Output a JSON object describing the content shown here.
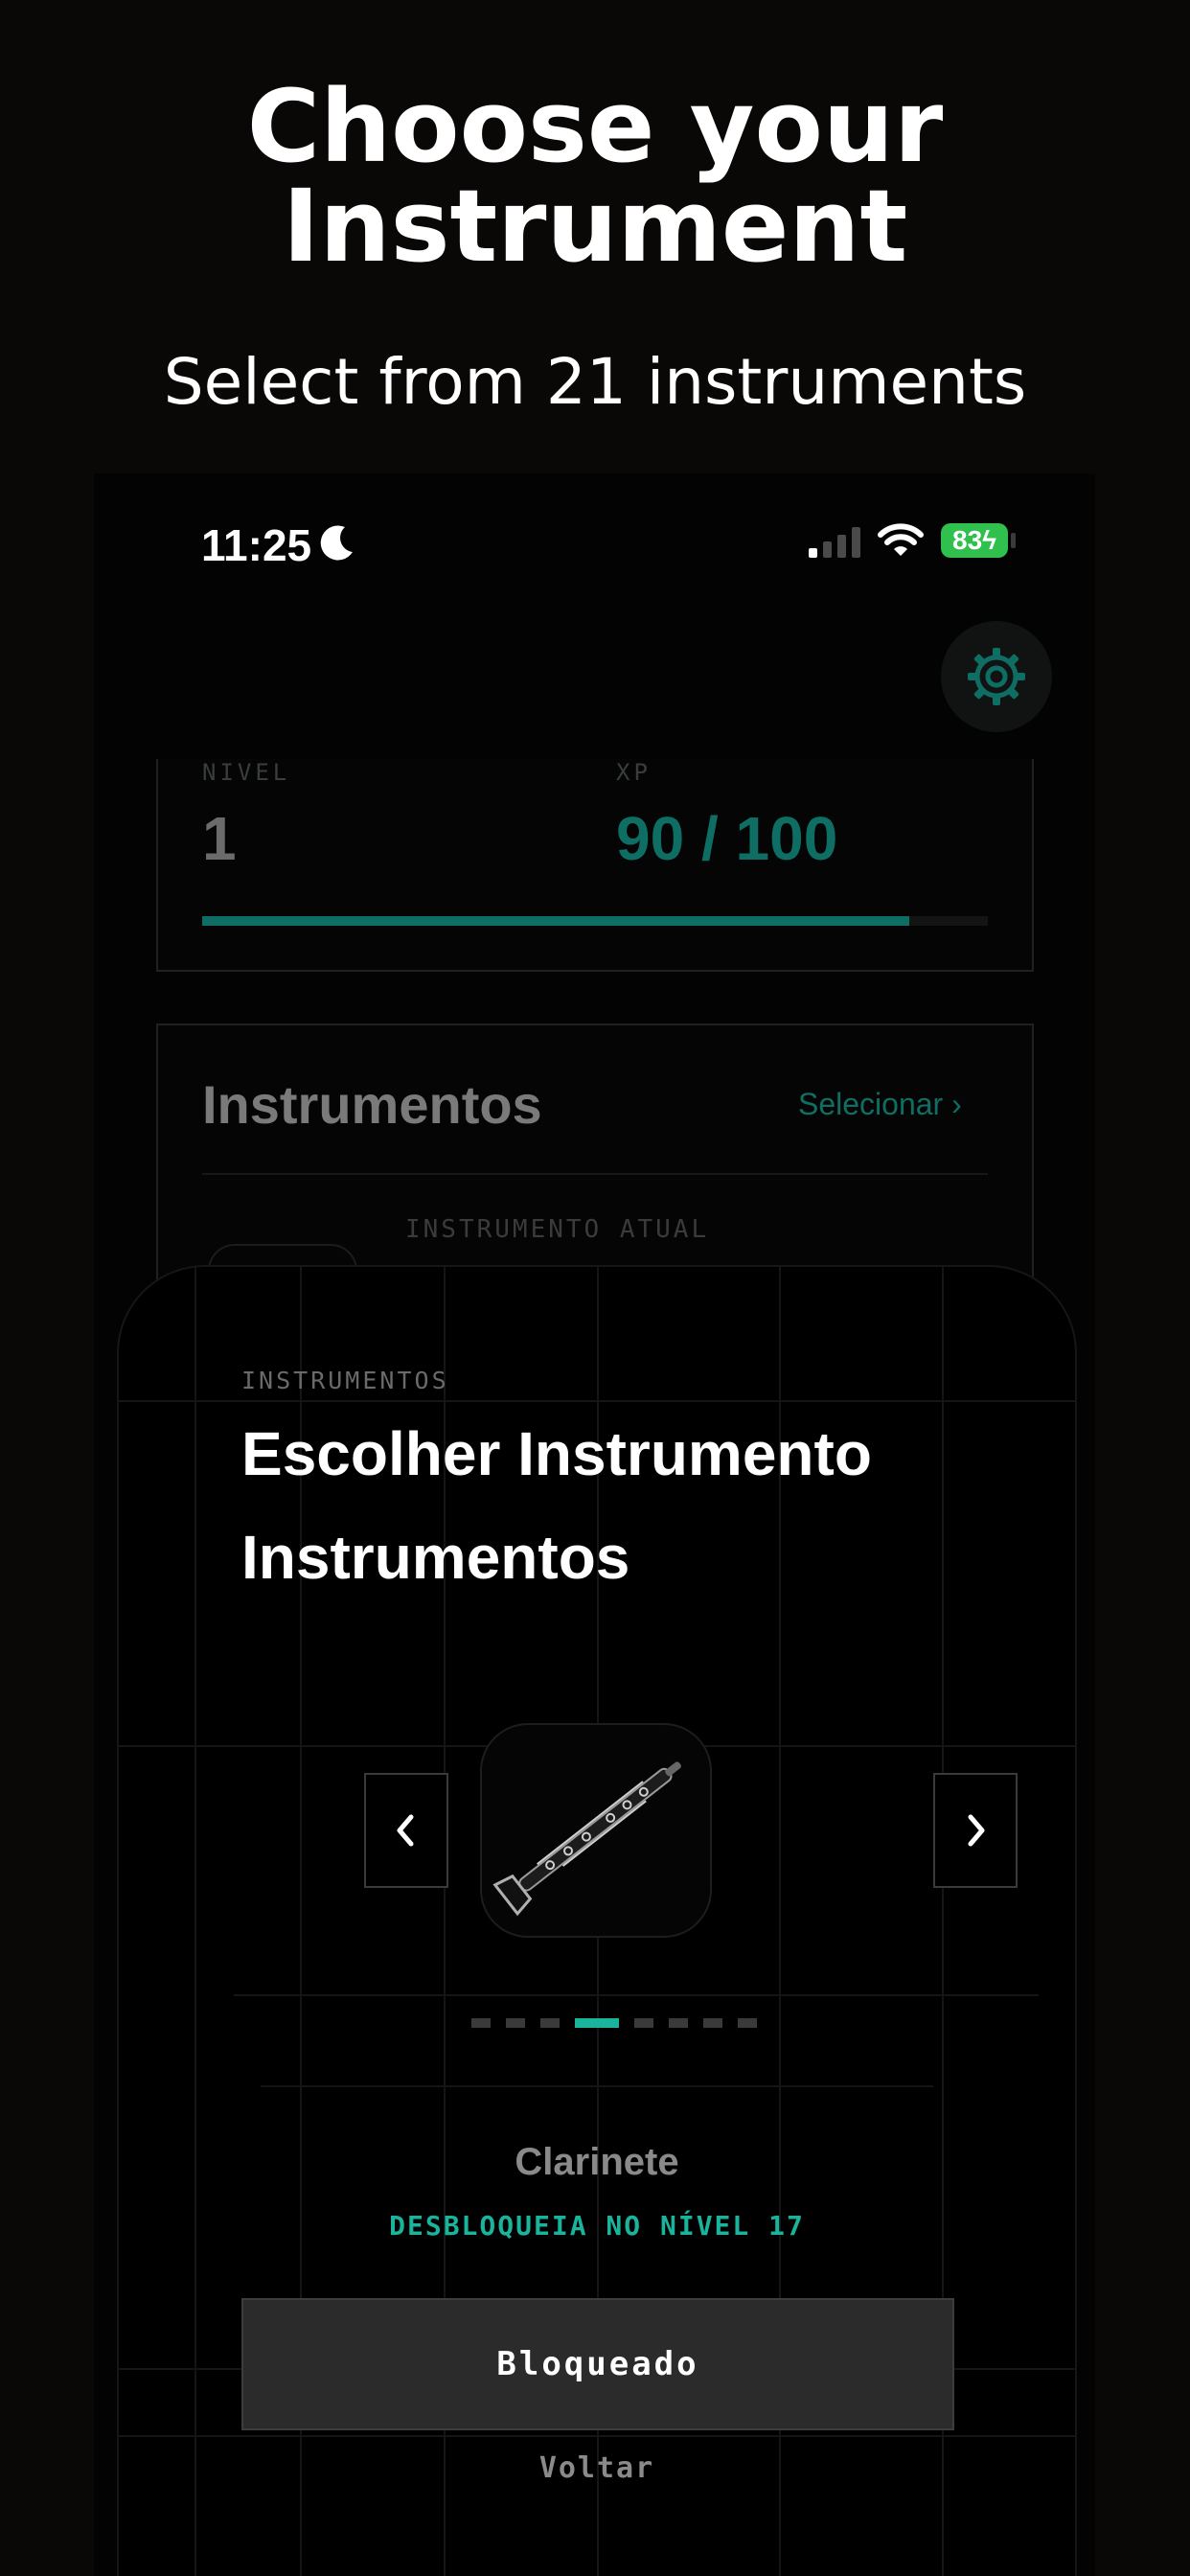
{
  "promo": {
    "headline_line1": "Choose your",
    "headline_line2": "Instrument",
    "subheadline": "Select from 21 instruments"
  },
  "status_bar": {
    "time": "11:25",
    "focus_icon": "moon-icon",
    "signal_icon": "cellular-signal-icon",
    "wifi_icon": "wifi-icon",
    "battery_level": "83",
    "battery_charging": true,
    "battery_color": "#30c04e"
  },
  "settings": {
    "icon": "gear-icon"
  },
  "progress": {
    "level_label": "NIVEL",
    "level_value": "1",
    "xp_label": "XP",
    "xp_value": "90 / 100",
    "xp_fraction": 0.9
  },
  "instruments_card": {
    "title": "Instrumentos",
    "select_label": "Selecionar",
    "current_label": "INSTRUMENTO ATUAL"
  },
  "picker": {
    "kicker": "INSTRUMENTOS",
    "title": "Escolher Instrumento",
    "subtitle": "Instrumentos",
    "prev_icon": "chevron-left-icon",
    "next_icon": "chevron-right-icon",
    "instrument_icon": "clarinet-icon",
    "page_count": 8,
    "active_page": 4,
    "instrument_name": "Clarinete",
    "unlock_text": "DESBLOQUEIA NO NÍVEL 17",
    "action_label": "Bloqueado",
    "back_label": "Voltar"
  },
  "colors": {
    "accent": "#1ab39c",
    "accent_dim": "#0f6e63",
    "background": "#0a0707"
  }
}
